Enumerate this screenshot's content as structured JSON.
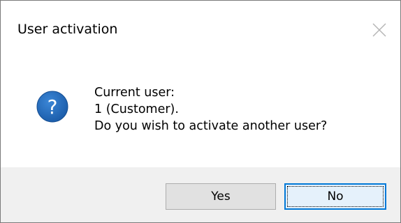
{
  "window": {
    "title": "User activation"
  },
  "titlebar": {
    "close_icon": "close-icon"
  },
  "message": {
    "icon": "question-icon",
    "lines": [
      "Current user:",
      "1 (Customer).",
      "Do you wish to activate another user?"
    ]
  },
  "buttons": {
    "yes_label": "Yes",
    "no_label": "No"
  },
  "colors": {
    "icon_blue": "#1e64b4",
    "focus_border": "#0078d7",
    "footer_bg": "#f0f0f0"
  }
}
